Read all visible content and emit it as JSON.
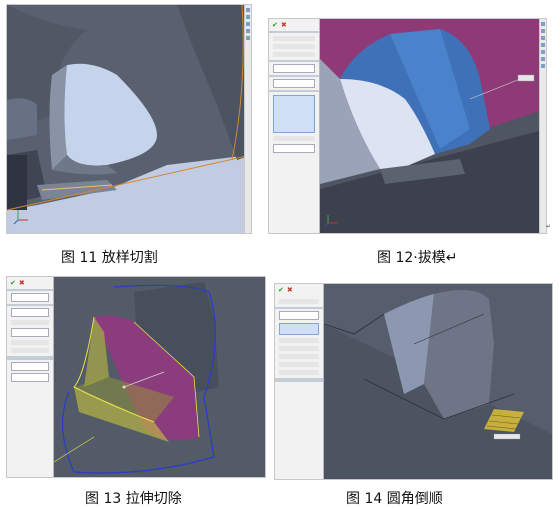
{
  "figures": [
    {
      "id": "fig11",
      "caption": "图 11 放样切割"
    },
    {
      "id": "fig12",
      "caption": "图 12·拔模↵"
    },
    {
      "id": "fig13",
      "caption": "图 13 拉伸切除"
    },
    {
      "id": "fig14",
      "caption": "图 14 圆角倒顺"
    }
  ],
  "return_mark": "↵",
  "icons": [
    "triad-icon",
    "check-icon",
    "close-icon",
    "feature-manager-panel"
  ]
}
